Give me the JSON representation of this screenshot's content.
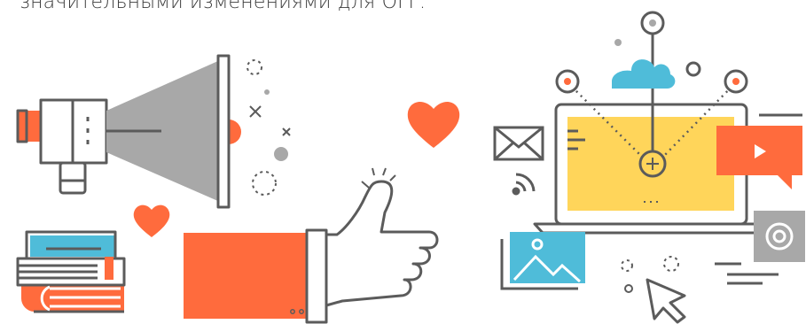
{
  "caption": "значительными изменениями для ОГГ.",
  "colors": {
    "line": "#5b5b5b",
    "gray": "#a8a8a8",
    "orange": "#ff6b3d",
    "yellow": "#ffd55a",
    "blue": "#4fbcd9",
    "white": "#ffffff"
  },
  "icons": [
    "megaphone-icon",
    "heart-icon",
    "books-icon",
    "thumbs-up-icon",
    "laptop-icon",
    "cloud-icon",
    "envelope-icon",
    "rss-icon",
    "video-play-icon",
    "at-sign-icon",
    "image-icon",
    "cursor-icon"
  ]
}
